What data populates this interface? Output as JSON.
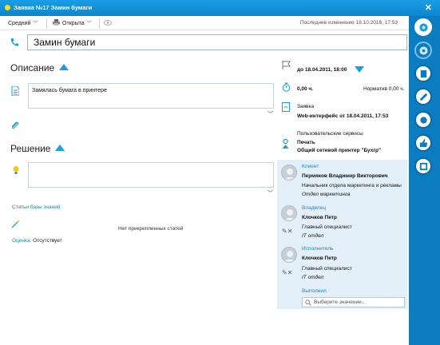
{
  "window": {
    "title": "Заявка №17 Замин бумаги",
    "close_glyph": "✕"
  },
  "toolbar": {
    "priority": "Средний",
    "status": "Открыта",
    "last_modified": "Последнее изменение 18.10.2016, 17:53"
  },
  "subject": {
    "value": "Замин бумаги"
  },
  "description": {
    "title": "Описание",
    "text": "Замялась бумага в принтере"
  },
  "solution": {
    "title": "Решение",
    "text": ""
  },
  "knowledge_base": {
    "link": "Статьи базы знаний",
    "empty": "Нет прикрепленных статей"
  },
  "rating": {
    "label": "Оценка:",
    "value": "Отсутствует"
  },
  "details": {
    "deadline": "до 18.04.2011, 18:00",
    "time_spent": "0,00 ч.",
    "norm": "Норматив 0,00 ч.",
    "request_label": "Заявка",
    "request_source": "Web-интерфейс от 18.04.2011, 17:53",
    "services_label": "Пользовательские сервисы",
    "service": "Печать",
    "service_item": "Общий сетевой принтер \"Бухгр\""
  },
  "people": {
    "client": {
      "role": "Клиент",
      "name": "Пермяков Владимир Викторович",
      "position": "Начальник отдела маркетинга и рекламы",
      "dept": "Отдел маркетинга"
    },
    "owner": {
      "role": "Владелец",
      "name": "Клочков Петр",
      "position": "Главный специалист",
      "dept": "IT отдел"
    },
    "executor": {
      "role": "Исполнитель",
      "name": "Клочков Петр",
      "position": "Главный специалист",
      "dept": "IT отдел"
    },
    "done": {
      "label": "Выполнил",
      "placeholder": "Выберите значение..."
    }
  },
  "colors": {
    "accent": "#1a9ee6",
    "rail": "#0c7cc0",
    "panel": "#e4f0f9"
  },
  "icons": [
    "phone-icon",
    "document-icon",
    "paperclip-icon",
    "lightbulb-icon",
    "wand-icon",
    "flag-icon",
    "stopwatch-icon",
    "request-icon",
    "service-icon",
    "settings-icon",
    "eye-icon",
    "printer-icon"
  ]
}
